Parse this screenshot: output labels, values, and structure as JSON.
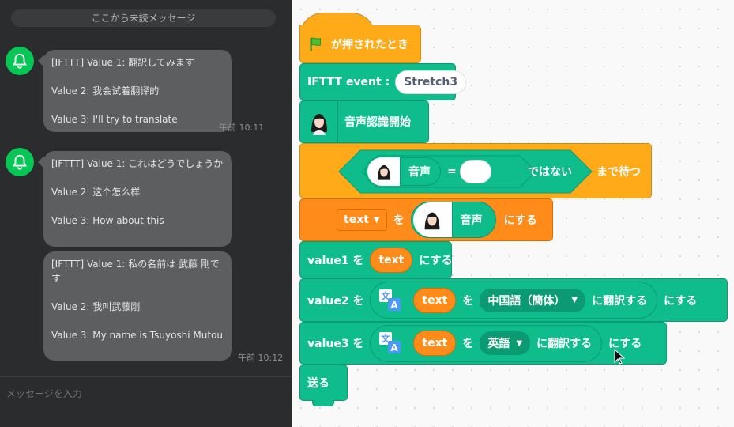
{
  "chat": {
    "unread_label": "ここから未読メッセージ",
    "messages": [
      {
        "lines": [
          "[IFTTT] Value 1: 翻訳してみます",
          "Value 2: 我会试着翻译的",
          "Value 3: I'll try to translate"
        ],
        "time": "午前 10:11"
      },
      {
        "lines": [
          "[IFTTT] Value 1: これはどうでしょうか",
          "Value 2: 这个怎么样",
          "Value 3: How about this"
        ],
        "time": ""
      },
      {
        "lines": [
          "[IFTTT] Value 1: 私の名前は 武藤 剛です",
          "Value 2: 我叫武藤刚",
          "Value 3: My name is Tsuyoshi Mutou"
        ],
        "time": "午前 10:12"
      }
    ],
    "input_placeholder": "メッセージを入力"
  },
  "blocks": {
    "hat": {
      "label": "が押されたとき"
    },
    "ifttt": {
      "label": "IFTTT event :",
      "value": "Stretch3"
    },
    "speech_start": {
      "label": "音声認識開始"
    },
    "wait": {
      "voice": "音声",
      "equals": "=",
      "not": "ではない",
      "label": "まで待つ"
    },
    "set_text": {
      "var": "text",
      "wo": "を",
      "voice": "音声",
      "suffix": "にする"
    },
    "value1": {
      "label": "value1 を",
      "var": "text",
      "suffix": "にする"
    },
    "value2": {
      "label": "value2 を",
      "var": "text",
      "wo": "を",
      "lang": "中国語（簡体）",
      "translate": "に翻訳する",
      "suffix": "にする"
    },
    "value3": {
      "label": "value3 を",
      "var": "text",
      "wo": "を",
      "lang": "英語",
      "translate": "に翻訳する",
      "suffix": "にする"
    },
    "send": {
      "label": "送る"
    }
  },
  "colors": {
    "line_green": "#06c755",
    "block_green": "#0fbd8c",
    "block_orange": "#ff8c1a",
    "block_yellow": "#ffab19"
  }
}
